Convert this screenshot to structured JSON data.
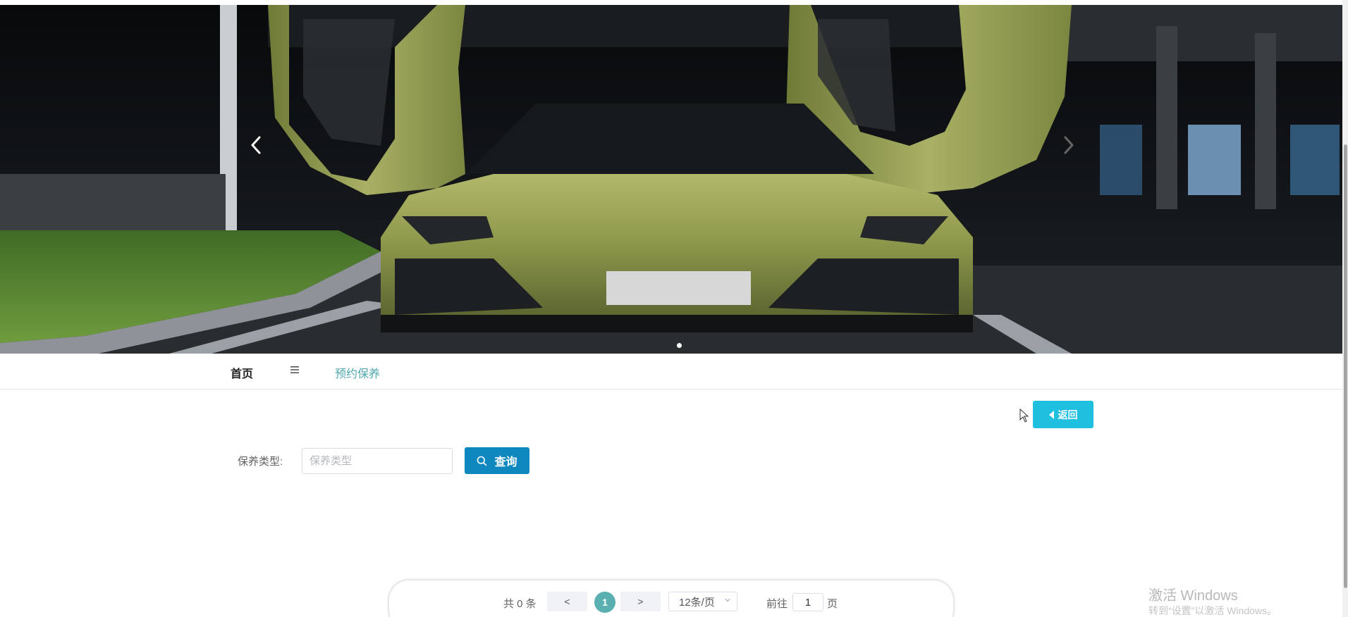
{
  "banner": {
    "image_subject": "green supercar with doors open",
    "prev_icon": "chevron-left-icon",
    "next_icon": "chevron-right-icon",
    "dots_count": 1,
    "active_dot": 1
  },
  "nav": {
    "home": "首页",
    "menu_icon": "menu-icon",
    "current": "预约保养"
  },
  "back_button": {
    "label": "返回",
    "icon": "caret-left-icon"
  },
  "search": {
    "label": "保养类型:",
    "placeholder": "保养类型",
    "value": "",
    "button_label": "查询",
    "button_icon": "search-icon"
  },
  "pagination": {
    "total_text": "共 0 条",
    "prev_label": "<",
    "next_label": ">",
    "current_page": "1",
    "page_size": "12条/页",
    "goto_prefix": "前往",
    "goto_value": "1",
    "goto_suffix": "页"
  },
  "watermark": {
    "title": "激活 Windows",
    "subtitle": "转到“设置”以激活 Windows。"
  },
  "colors": {
    "accent_teal": "#5ab0b0",
    "back_button": "#1fbfe0",
    "query_button": "#0f88bf",
    "nav_current": "#4fa8b0"
  }
}
